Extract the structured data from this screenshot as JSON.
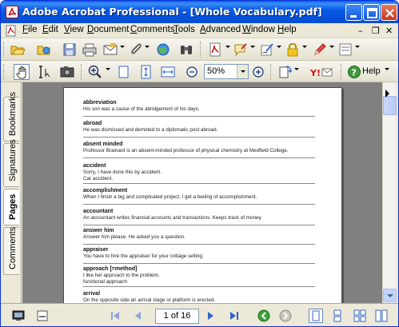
{
  "window": {
    "title": "Adobe Acrobat Professional - [Whole Vocabulary.pdf]"
  },
  "menu": {
    "items": [
      {
        "label": "File",
        "mnemonic": "F",
        "rest": "ile"
      },
      {
        "label": "Edit",
        "mnemonic": "E",
        "rest": "dit"
      },
      {
        "label": "View",
        "mnemonic": "V",
        "rest": "iew"
      },
      {
        "label": "Document",
        "mnemonic": "D",
        "rest": "ocument"
      },
      {
        "label": "Comments",
        "mnemonic": "C",
        "rest": "omments"
      },
      {
        "label": "Tools",
        "mnemonic": "T",
        "rest": "ools"
      },
      {
        "label": "Advanced",
        "mnemonic": "A",
        "rest": "dvanced"
      },
      {
        "label": "Window",
        "mnemonic": "W",
        "rest": "indow"
      },
      {
        "label": "Help",
        "mnemonic": "H",
        "rest": "elp"
      }
    ],
    "mdi_minimize": "–",
    "mdi_restore": "❐",
    "mdi_close": "✕"
  },
  "toolbar2": {
    "zoom_value": "50%",
    "help_label": "Help"
  },
  "nav_tabs": {
    "bookmarks": "Bookmarks",
    "signatures": "Signatures",
    "pages": "Pages",
    "comments": "Comments"
  },
  "document": {
    "entries": [
      {
        "word": "abbreviation",
        "example": "His son was a cause of the abridgement of his days."
      },
      {
        "word": "abroad",
        "example": "He was dismissed and demoted to a diplomatic post abroad."
      },
      {
        "word": "absent minded",
        "example": "Professor Brainard is an absent-minded professor of physical chemistry at Medfield College."
      },
      {
        "word": "accident",
        "example": "Sorry, I have done this by accident.\nCar accident."
      },
      {
        "word": "accomplishment",
        "example": "When I finish a big and complicated project, I get a feeling of accomplishment."
      },
      {
        "word": "accountant",
        "example": "An accountant writes financial accounts and transactions. Keeps track of money."
      },
      {
        "word": "answer him",
        "example": "Answer him please. He asked you a question."
      },
      {
        "word": "appraiser",
        "example": "You have to hire the appraiser for your cottage selling."
      },
      {
        "word": "approach [=method]",
        "example": "I like her approach to the problem.\nfunctional approach"
      },
      {
        "word": "arrival",
        "example": "On the opposite side an arrival stage or platform is erected."
      }
    ]
  },
  "statusbar": {
    "page_indicator": "1 of 16"
  }
}
